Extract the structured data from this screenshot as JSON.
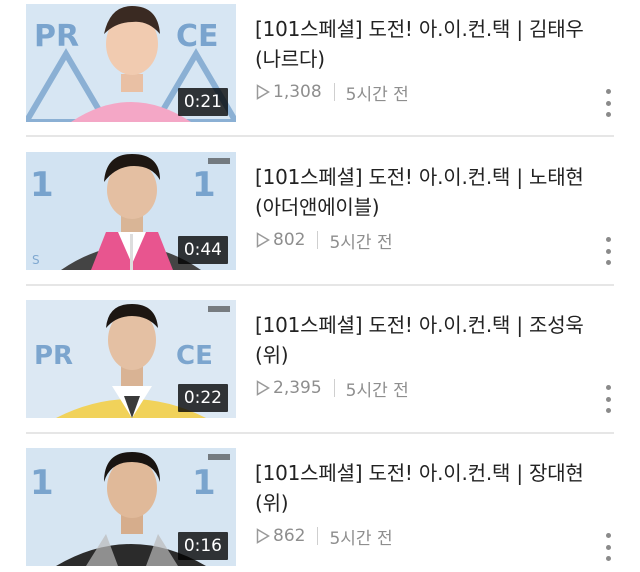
{
  "videos": [
    {
      "title": "[101스페셜] 도전! 아.이.컨.택 | 김태우 (나르다)",
      "duration": "0:21",
      "views": "1,308",
      "age": "5시간 전",
      "shirt_color": "#f4a7c6",
      "bg_color": "#d7e6f3"
    },
    {
      "title": "[101스페셜] 도전! 아.이.컨.택 | 노태현 (아더앤에이블)",
      "duration": "0:44",
      "views": "802",
      "age": "5시간 전",
      "shirt_color": "#e8558f",
      "bg_color": "#d2e3f2"
    },
    {
      "title": "[101스페셜] 도전! 아.이.컨.택 | 조성욱 (위)",
      "duration": "0:22",
      "views": "2,395",
      "age": "5시간 전",
      "shirt_color": "#f1d25a",
      "bg_color": "#dce8f3"
    },
    {
      "title": "[101스페셜] 도전! 아.이.컨.택 | 장대현 (위)",
      "duration": "0:16",
      "views": "862",
      "age": "5시간 전",
      "shirt_color": "#2b2b2b",
      "bg_color": "#d6e5f2"
    }
  ],
  "icons": {
    "play": "play-outline-icon",
    "more": "more-vertical-icon"
  },
  "colors": {
    "accent_blue": "#2f6fb0",
    "meta_gray": "#8e8e8e"
  }
}
